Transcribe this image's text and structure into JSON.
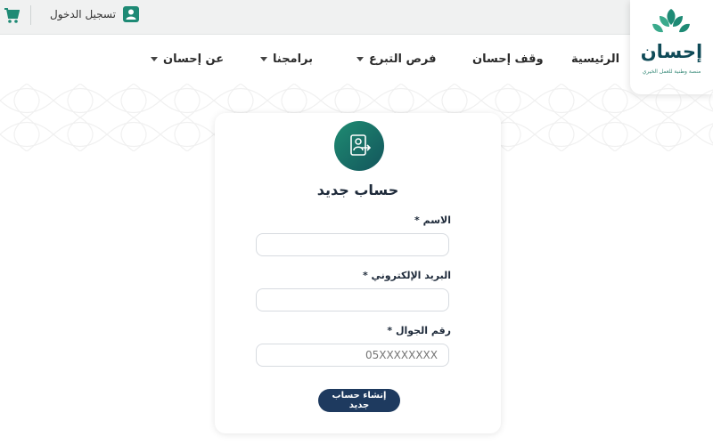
{
  "topbar": {
    "login_label": "تسجيل الدخول",
    "cart_icon": "shopping-cart-icon",
    "user_icon": "user-icon"
  },
  "nav": {
    "items": [
      {
        "label": "الرئيسية",
        "dropdown": false
      },
      {
        "label": "وقف إحسان",
        "dropdown": false
      },
      {
        "label": "فرص التبرع",
        "dropdown": true
      },
      {
        "label": "برامجنا",
        "dropdown": true
      },
      {
        "label": "عن إحسان",
        "dropdown": true
      }
    ]
  },
  "logo": {
    "title": "إحسان",
    "subtitle": "منصة وطنية للعمل الخيري"
  },
  "form": {
    "title": "حساب جديد",
    "fields": [
      {
        "label": "الاسم *",
        "value": "",
        "placeholder": ""
      },
      {
        "label": "البريد الإلكتروني *",
        "value": "",
        "placeholder": ""
      },
      {
        "label": "رقم الجوال *",
        "value": "",
        "placeholder": "05XXXXXXXX"
      }
    ],
    "submit_label": "إنشاء حساب جديد"
  },
  "colors": {
    "brand_green": "#1e8a75",
    "brand_navy": "#1e3a5f",
    "logo_teal": "#0f4a57"
  }
}
